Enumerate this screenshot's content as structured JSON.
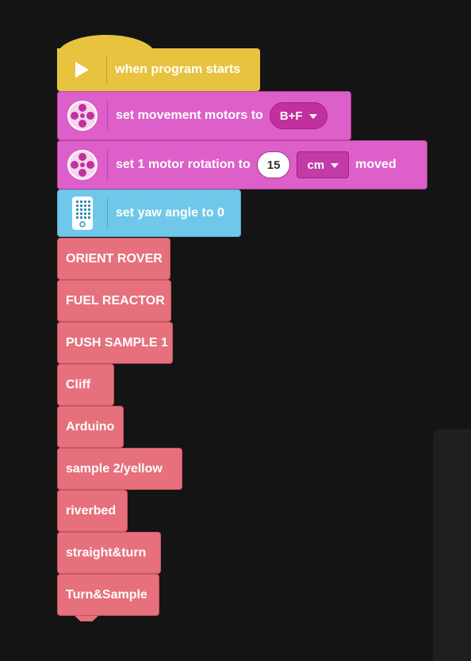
{
  "hat_block": {
    "label": "when program starts",
    "icon": "play-icon"
  },
  "motor_block_1": {
    "label": "set movement motors to",
    "dropdown_value": "B+F",
    "icon": "motor-icon"
  },
  "motor_block_2": {
    "label": "set 1 motor rotation to",
    "input_value": "15",
    "unit_value": "cm",
    "suffix": "moved",
    "icon": "motor-icon"
  },
  "sensor_block": {
    "label": "set yaw angle to 0",
    "icon": "hub-icon"
  },
  "my_blocks": [
    {
      "label": "ORIENT ROVER"
    },
    {
      "label": "FUEL REACTOR"
    },
    {
      "label": "PUSH SAMPLE 1"
    },
    {
      "label": "Cliff"
    },
    {
      "label": "Arduino"
    },
    {
      "label": "sample 2/yellow"
    },
    {
      "label": "riverbed"
    },
    {
      "label": "straight&turn"
    },
    {
      "label": "Turn&Sample"
    }
  ],
  "colors": {
    "background": "#141414",
    "events": "#e8c33f",
    "motors": "#dd5fc9",
    "sensors": "#6fc8ea",
    "my_blocks": "#e6707c"
  }
}
